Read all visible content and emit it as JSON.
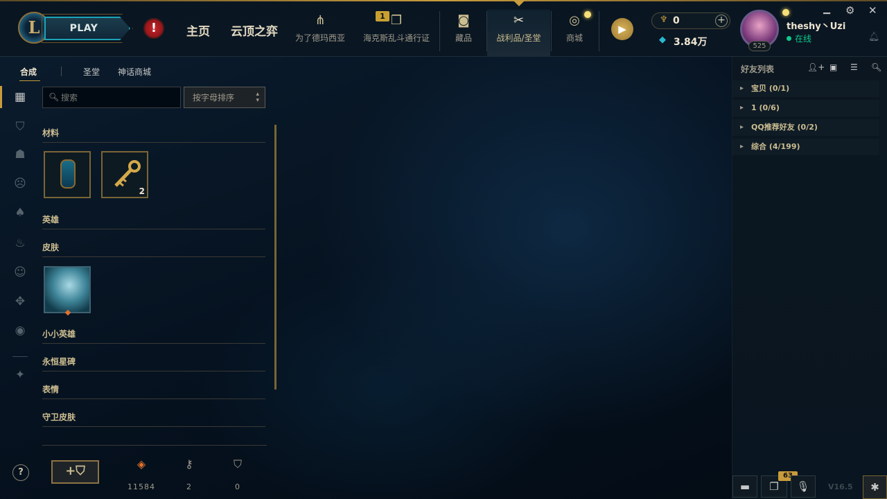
{
  "topbar": {
    "play_label": "PLAY",
    "nav_main": [
      "主页",
      "云顶之弈"
    ],
    "nav_items": [
      {
        "label": "为了德玛西亚",
        "icon": "trident-icon"
      },
      {
        "label": "海克斯乱斗通行证",
        "icon": "cards-icon",
        "badge": "1"
      },
      {
        "label": "藏品",
        "icon": "backpack-icon"
      },
      {
        "label": "战利品/圣堂",
        "icon": "loot-tools-icon",
        "active": true
      },
      {
        "label": "商城",
        "icon": "coins-icon"
      }
    ],
    "currency_top": "0",
    "currency_bottom": "3.84万",
    "level": "525",
    "username": "theshy丶Uzi",
    "status": "在线",
    "accent_color": "#c89b3c"
  },
  "left": {
    "subtabs": [
      "合成",
      "圣堂",
      "神话商城"
    ],
    "search_placeholder": "搜索",
    "sort_label": "按字母排序",
    "sections": {
      "materials": "材料",
      "champions": "英雄",
      "skins": "皮肤",
      "little_legends": "小小英雄",
      "eternals": "永恒星碑",
      "emotes": "表情",
      "ward_skins": "守卫皮肤"
    },
    "key_count": "2",
    "resources": [
      {
        "name": "orange-essence-icon",
        "value": "11584"
      },
      {
        "name": "key-fragment-icon",
        "value": "2"
      },
      {
        "name": "chest-icon",
        "value": "0"
      }
    ]
  },
  "friends": {
    "title": "好友列表",
    "groups": [
      "宝贝 (0/1)",
      "1 (0/6)",
      "QQ推荐好友 (0/2)",
      "综合 (4/199)"
    ],
    "notif_count": "63",
    "version": "V16.5"
  }
}
